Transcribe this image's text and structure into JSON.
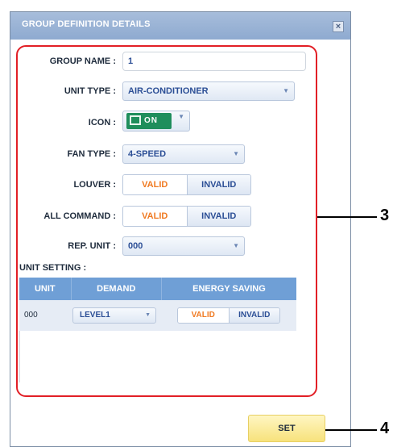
{
  "dialog": {
    "title": "GROUP DEFINITION DETAILS",
    "close_label": "×"
  },
  "form": {
    "group_name": {
      "label": "GROUP NAME :",
      "value": "1"
    },
    "unit_type": {
      "label": "UNIT TYPE :",
      "value": "AIR-CONDITIONER"
    },
    "icon": {
      "label": "ICON :",
      "value": "ON"
    },
    "fan_type": {
      "label": "FAN TYPE :",
      "value": "4-SPEED"
    },
    "louver": {
      "label": "LOUVER :",
      "valid": "VALID",
      "invalid": "INVALID"
    },
    "all_command": {
      "label": "ALL COMMAND :",
      "valid": "VALID",
      "invalid": "INVALID"
    },
    "rep_unit": {
      "label": "REP. UNIT :",
      "value": "000"
    }
  },
  "unit_setting": {
    "label": "UNIT SETTING :",
    "columns": [
      "UNIT",
      "DEMAND",
      "ENERGY SAVING"
    ],
    "rows": [
      {
        "unit": "000",
        "demand": "LEVEL1",
        "valid": "VALID",
        "invalid": "INVALID"
      }
    ]
  },
  "footer": {
    "set_label": "SET"
  },
  "callouts": {
    "a": "3",
    "b": "4"
  },
  "colors": {
    "title_bar": "#8eaad0",
    "accent_orange": "#f07a22",
    "link_blue": "#2c4f96",
    "highlight_red": "#e21f26",
    "icon_green": "#1f8e5c"
  }
}
